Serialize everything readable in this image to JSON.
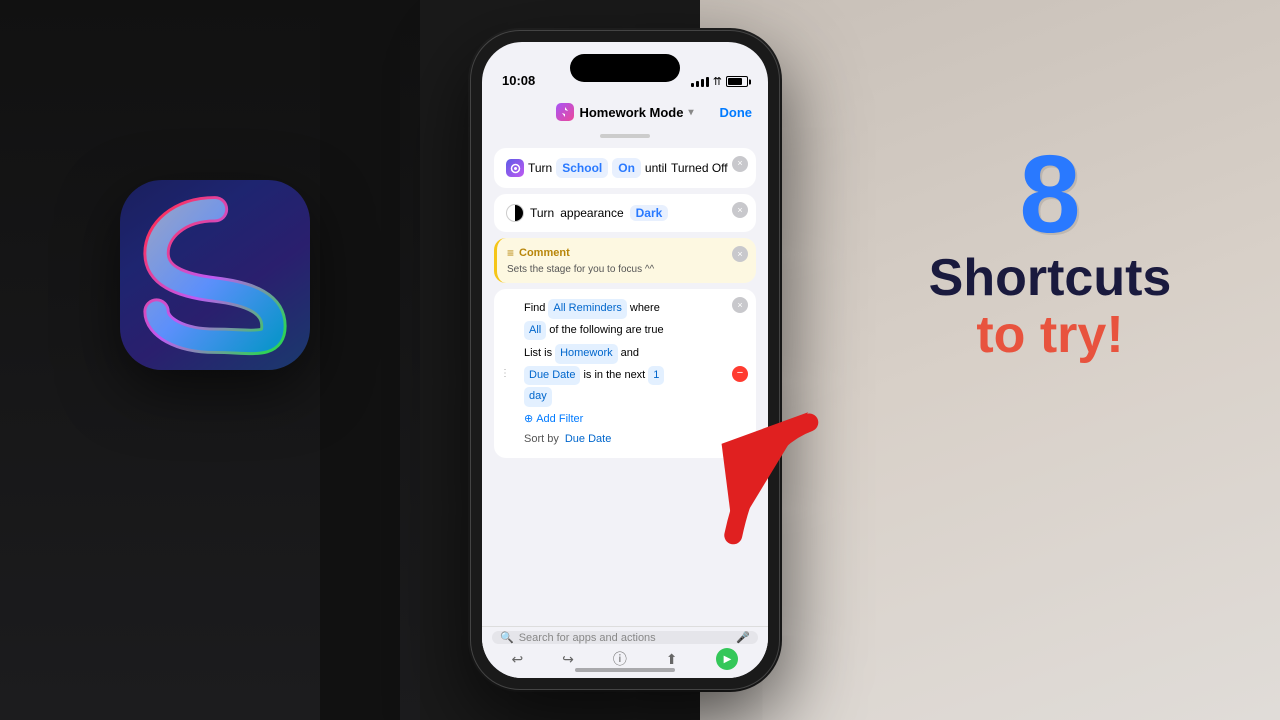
{
  "background": {
    "left_color": "#1a1a1e",
    "right_color": "#d8d0c8"
  },
  "shortcuts_icon": {
    "alt": "Shortcuts App Icon"
  },
  "phone": {
    "status": {
      "time": "10:08",
      "signal": "●●●●",
      "wifi": "wifi",
      "battery": "75%"
    },
    "header": {
      "title": "Homework Mode",
      "chevron": "▾",
      "done": "Done"
    },
    "cards": {
      "school_card": {
        "turn_label": "Turn",
        "school_label": "School",
        "on_label": "On",
        "until_label": "until",
        "turned_off_label": "Turned Off"
      },
      "appearance_card": {
        "turn_label": "Turn",
        "appearance_label": "appearance",
        "dark_label": "Dark"
      },
      "comment_card": {
        "header": "Comment",
        "text": "Sets the stage for you to focus ^^"
      },
      "find_card": {
        "find_label": "Find",
        "all_reminders_label": "All Reminders",
        "where_label": "where",
        "all_label": "All",
        "following_label": "of the following are true",
        "list_label": "List",
        "is_label": "is",
        "homework_label": "Homework",
        "and_label": "and",
        "due_date_label": "Due Date",
        "is_in_label": "is in the next",
        "number": "1",
        "day_label": "day",
        "add_filter": "Add Filter",
        "sort_by": "Sort by",
        "sort_value": "Due Date"
      },
      "search_bar": {
        "placeholder": "Search for apps and actions"
      }
    }
  },
  "right_panel": {
    "number": "8",
    "line1": "Shortcuts",
    "line2": "to try!"
  },
  "icons": {
    "close": "×",
    "drag": "⋮",
    "add": "⊕",
    "search": "🔍",
    "mic": "🎤",
    "back": "↩",
    "info": "ⓘ",
    "share": "↑",
    "play": "▶"
  }
}
